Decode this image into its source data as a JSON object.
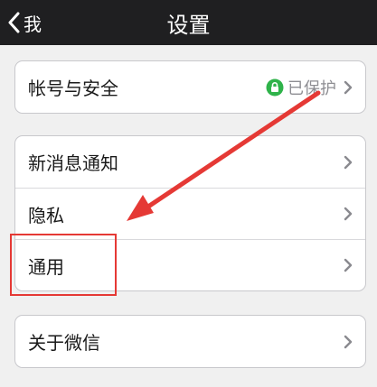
{
  "navbar": {
    "back_label": "我",
    "title": "设置"
  },
  "groups": [
    {
      "items": [
        {
          "label": "帐号与安全",
          "status": "已保护",
          "status_icon": "lock-icon"
        }
      ]
    },
    {
      "items": [
        {
          "label": "新消息通知"
        },
        {
          "label": "隐私"
        },
        {
          "label": "通用"
        }
      ]
    },
    {
      "items": [
        {
          "label": "关于微信"
        }
      ]
    }
  ],
  "colors": {
    "navbar_bg": "#1f1f21",
    "page_bg": "#f0f0f0",
    "lock_green": "#2fb34a",
    "annotation_red": "#e53935"
  }
}
